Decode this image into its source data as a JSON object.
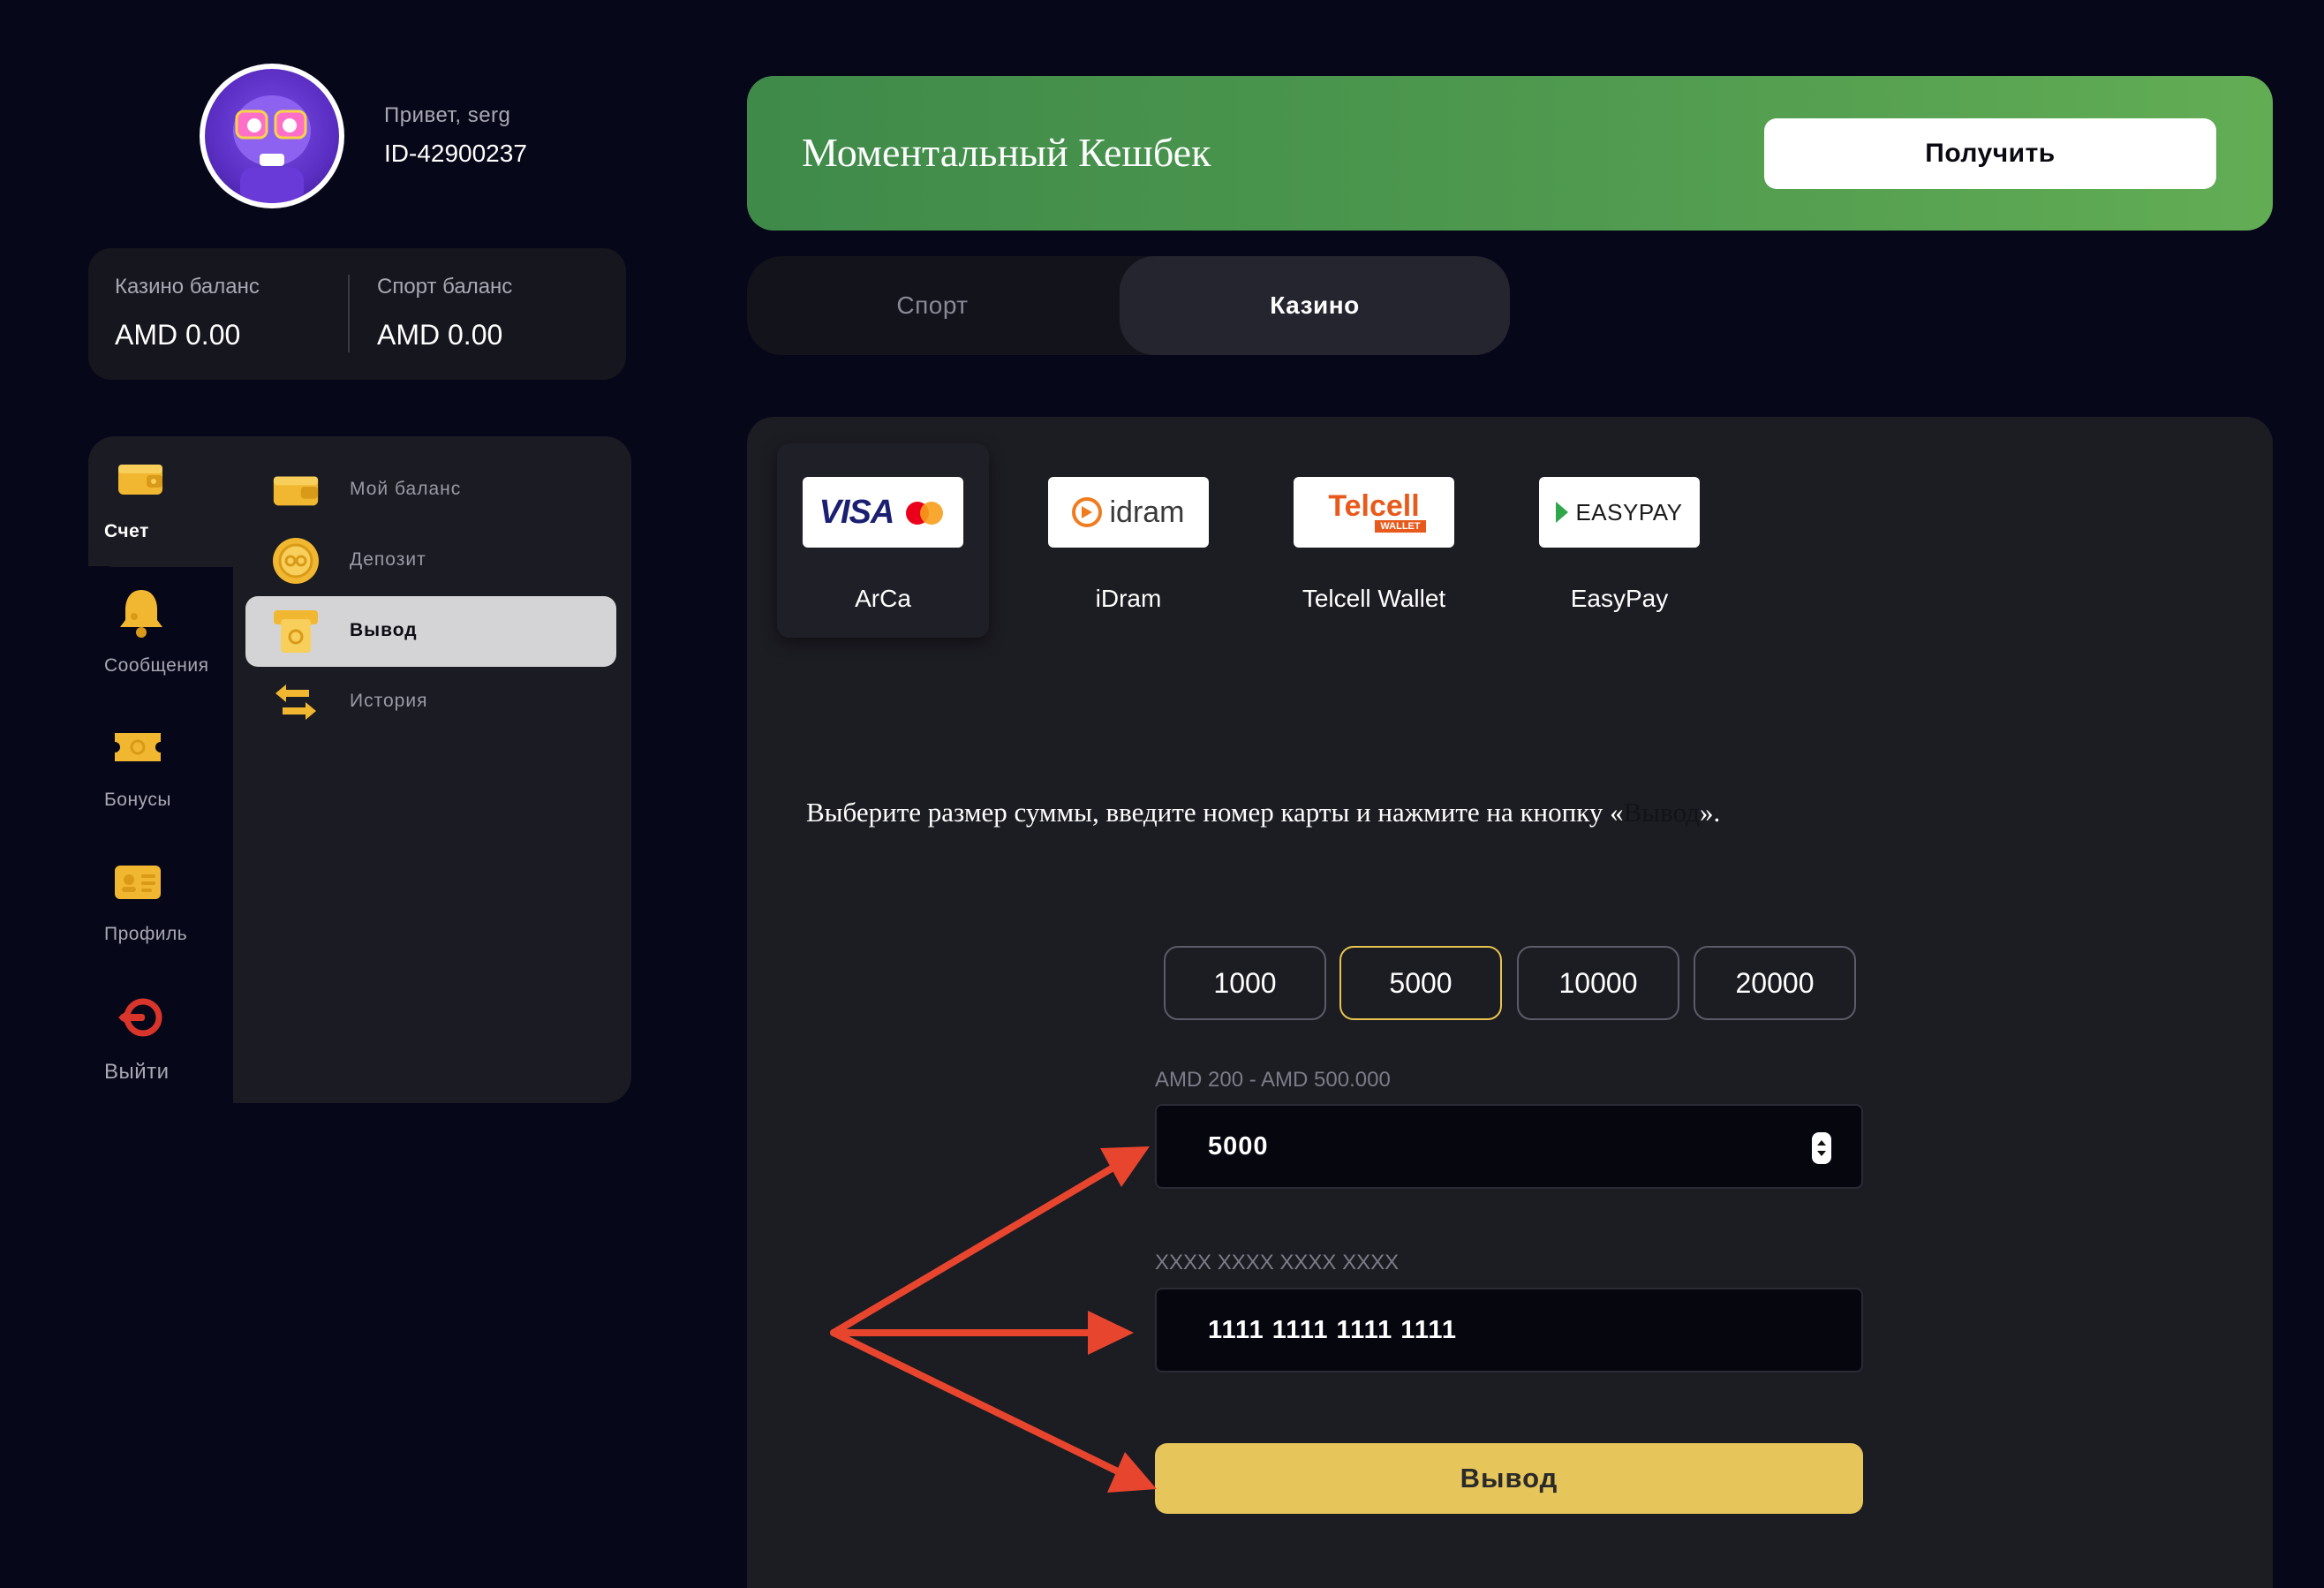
{
  "user": {
    "greeting": "Привет, serg",
    "id": "ID-42900237"
  },
  "balances": {
    "casino_label": "Казино баланс",
    "casino_value": "AMD 0.00",
    "sport_label": "Спорт баланс",
    "sport_value": "AMD 0.00"
  },
  "nav": {
    "items": [
      {
        "label": "Счет",
        "icon": "wallet-icon",
        "active": true
      },
      {
        "label": "Сообщения",
        "icon": "bell-icon"
      },
      {
        "label": "Бонусы",
        "icon": "ticket-icon"
      },
      {
        "label": "Профиль",
        "icon": "id-card-icon"
      },
      {
        "label": "Выйти",
        "icon": "logout-icon"
      }
    ],
    "sub_items": [
      {
        "label": "Мой баланс",
        "icon": "wallet-icon"
      },
      {
        "label": "Депозит",
        "icon": "coin-icon"
      },
      {
        "label": "Вывод",
        "icon": "cash-out-icon",
        "active": true
      },
      {
        "label": "История",
        "icon": "exchange-arrows-icon"
      }
    ]
  },
  "cashback": {
    "title": "Моментальный Кешбек",
    "button": "Получить"
  },
  "toggle": {
    "sport": "Спорт",
    "casino": "Казино",
    "active": "Казино"
  },
  "payment_methods": [
    {
      "name": "ArCa",
      "logo": "visa-mastercard",
      "selected": true
    },
    {
      "name": "iDram",
      "logo": "idram"
    },
    {
      "name": "Telcell Wallet",
      "logo": "telcell"
    },
    {
      "name": "EasyPay",
      "logo": "easypay"
    }
  ],
  "logos": {
    "visa": "VISA",
    "mastercard": "mastercard",
    "idram": "idram",
    "telcell": "Telcell",
    "telcell_sub": "WALLET",
    "easypay": "EASYPAY"
  },
  "instruction": {
    "before": "Выберите размер суммы, введите номер карты и нажмите на кнопку «",
    "word": "Вывод",
    "after": "»."
  },
  "amounts": {
    "options": [
      "1000",
      "5000",
      "10000",
      "20000"
    ],
    "selected": "5000"
  },
  "form": {
    "amount_hint": "AMD 200 - AMD 500.000",
    "amount_value": "5000",
    "card_hint": "XXXX XXXX XXXX XXXX",
    "card_value": "1111 1111 1111 1111",
    "submit": "Вывод"
  },
  "colors": {
    "background": "#07071a",
    "cashback_green": "#4f9a4f",
    "accent_yellow": "#e6c65a",
    "annotation_red": "#e8452e"
  }
}
